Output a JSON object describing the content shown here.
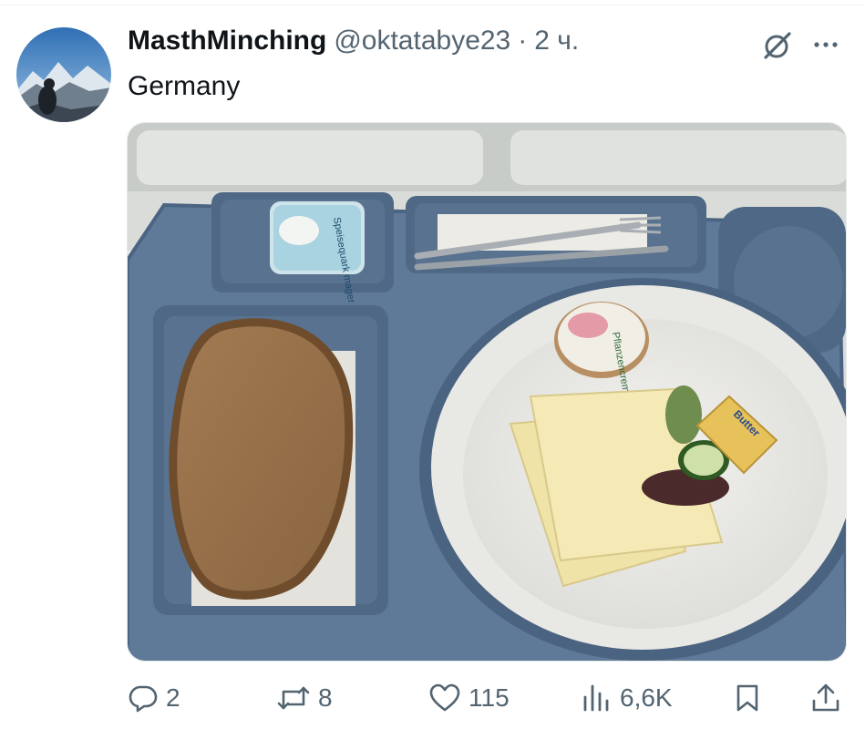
{
  "tweet": {
    "display_name": "MasthMinching",
    "handle": "@oktatabye23",
    "separator": "·",
    "time": "2 ч.",
    "text": "Germany"
  },
  "media": {
    "items": {
      "yogurt_lid": "Speisequark mager",
      "spread_label": "Pflanzencreme",
      "butter_label": "Butter"
    }
  },
  "actions": {
    "replies": "2",
    "reposts": "8",
    "likes": "115",
    "views": "6,6K"
  },
  "icons": {
    "reply": "reply-icon",
    "repost": "repost-icon",
    "like": "heart-icon",
    "views": "views-icon",
    "bookmark": "bookmark-icon",
    "share": "share-icon",
    "grok": "grok-icon",
    "more": "more-icon"
  },
  "colors": {
    "text_primary": "#0f1419",
    "text_secondary": "#536471",
    "tray": "#5f7a99"
  }
}
